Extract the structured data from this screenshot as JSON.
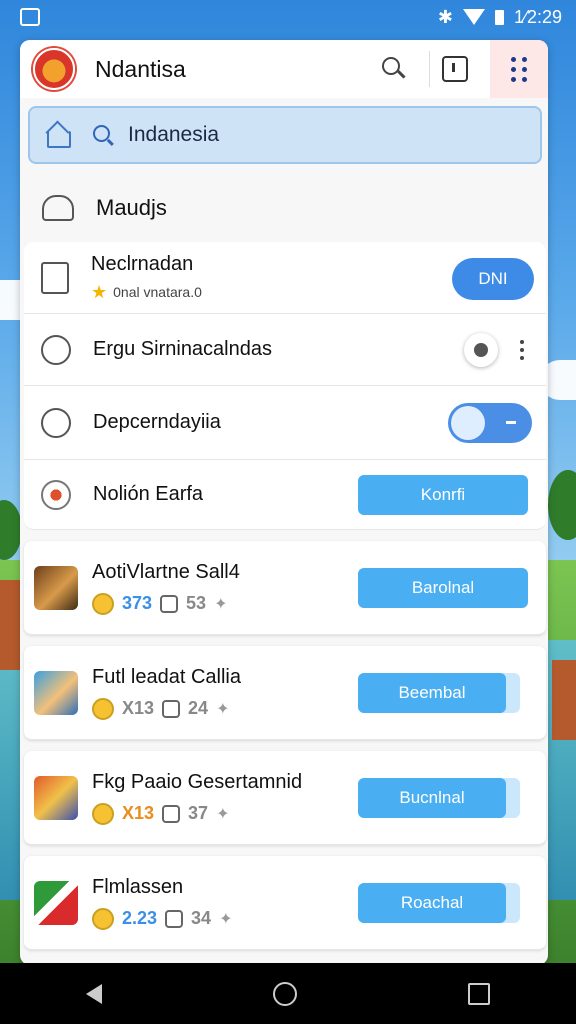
{
  "status_bar": {
    "time": "1⁄2:29",
    "icons": [
      "bluetooth-icon",
      "wifi-icon",
      "battery-icon"
    ]
  },
  "header": {
    "title": "Ndantisa",
    "icons": [
      "search-icon",
      "info-box-icon",
      "grid-dots-icon"
    ]
  },
  "search": {
    "value": "Indanesia"
  },
  "section": {
    "title": "Maudjs"
  },
  "settings_rows": [
    {
      "title": "Neclrnadan",
      "subtitle": "0nal vnatara.0",
      "button": "DNI"
    },
    {
      "title": "Ergu Sirninacalndas"
    },
    {
      "title": "Depcerndayiia"
    },
    {
      "title": "Nolión Earfa",
      "button": "Konrfi"
    }
  ],
  "apps": [
    {
      "title": "AotiVlartne Sall4",
      "rating": "373",
      "count": "53",
      "button": "Barolnal"
    },
    {
      "title": "Futl leadat Callia",
      "rating": "X13",
      "count": "24",
      "button": "Beembal"
    },
    {
      "title": "Fkg Paaio Gesertamnid",
      "rating": "X13",
      "count": "37",
      "button": "Bucnlnal"
    },
    {
      "title": "Flmlassen",
      "rating": "2.23",
      "count": "34",
      "button": "Roachal"
    }
  ],
  "colors": {
    "accent": "#3d8be6",
    "button": "#4aaef2",
    "search_bg": "#cfe3f6"
  }
}
